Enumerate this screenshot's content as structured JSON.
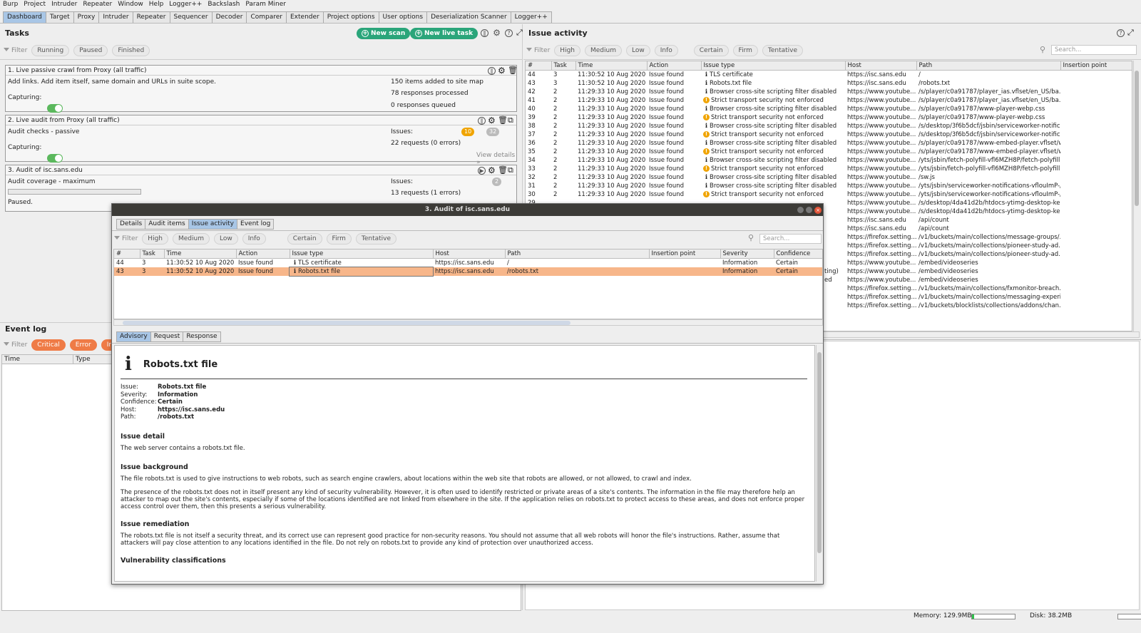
{
  "menubar": [
    "Burp",
    "Project",
    "Intruder",
    "Repeater",
    "Window",
    "Help",
    "Logger++",
    "Backslash",
    "Param Miner"
  ],
  "tabs": [
    "Dashboard",
    "Target",
    "Proxy",
    "Intruder",
    "Repeater",
    "Sequencer",
    "Decoder",
    "Comparer",
    "Extender",
    "Project options",
    "User options",
    "Deserialization Scanner",
    "Logger++"
  ],
  "active_tab": "Dashboard",
  "tasks": {
    "title": "Tasks",
    "new_scan": "New scan",
    "new_live_task": "New live task",
    "filter_label": "Filter",
    "filters": [
      "Running",
      "Paused",
      "Finished"
    ],
    "items": [
      {
        "title": "1. Live passive crawl from Proxy (all traffic)",
        "desc": "Add links. Add item itself, same domain and URLs in suite scope.",
        "capturing_label": "Capturing:",
        "stats": [
          "150 items added to site map",
          "78 responses processed",
          "0 responses queued"
        ]
      },
      {
        "title": "2. Live audit from Proxy (all traffic)",
        "desc": "Audit checks - passive",
        "capturing_label": "Capturing:",
        "issues_label": "Issues:",
        "badge_a": "10",
        "badge_b": "32",
        "requests": "22 requests (0 errors)",
        "view_details": "View details"
      },
      {
        "title": "3. Audit of isc.sans.edu",
        "desc": "Audit coverage - maximum",
        "issues_label": "Issues:",
        "badge_b": "2",
        "requests": "13 requests (1 errors)",
        "paused": "Paused."
      }
    ]
  },
  "eventlog": {
    "title": "Event log",
    "filter_label": "Filter",
    "filters": [
      "Critical",
      "Error",
      "Info"
    ],
    "columns": [
      "Time",
      "Type"
    ]
  },
  "issue_activity": {
    "title": "Issue activity",
    "filter_label": "Filter",
    "severity_filters": [
      "High",
      "Medium",
      "Low",
      "Info"
    ],
    "confidence_filters": [
      "Certain",
      "Firm",
      "Tentative"
    ],
    "search_placeholder": "Search...",
    "columns": [
      "#",
      "Task",
      "Time",
      "Action",
      "Issue type",
      "Host",
      "Path",
      "Insertion point"
    ],
    "rows": [
      [
        "44",
        "3",
        "11:30:52 10 Aug 2020",
        "Issue found",
        "i",
        "TLS certificate",
        "https://isc.sans.edu",
        "/"
      ],
      [
        "43",
        "3",
        "11:30:52 10 Aug 2020",
        "Issue found",
        "i",
        "Robots.txt file",
        "https://isc.sans.edu",
        "/robots.txt"
      ],
      [
        "42",
        "2",
        "11:29:33 10 Aug 2020",
        "Issue found",
        "i",
        "Browser cross-site scripting filter disabled",
        "https://www.youtube....",
        "/s/player/c0a91787/player_ias.vflset/en_US/ba..."
      ],
      [
        "41",
        "2",
        "11:29:33 10 Aug 2020",
        "Issue found",
        "w",
        "Strict transport security not enforced",
        "https://www.youtube....",
        "/s/player/c0a91787/player_ias.vflset/en_US/ba..."
      ],
      [
        "40",
        "2",
        "11:29:33 10 Aug 2020",
        "Issue found",
        "i",
        "Browser cross-site scripting filter disabled",
        "https://www.youtube....",
        "/s/player/c0a91787/www-player-webp.css"
      ],
      [
        "39",
        "2",
        "11:29:33 10 Aug 2020",
        "Issue found",
        "w",
        "Strict transport security not enforced",
        "https://www.youtube....",
        "/s/player/c0a91787/www-player-webp.css"
      ],
      [
        "38",
        "2",
        "11:29:33 10 Aug 2020",
        "Issue found",
        "i",
        "Browser cross-site scripting filter disabled",
        "https://www.youtube....",
        "/s/desktop/3f6b5dcf/jsbin/serviceworker-notific..."
      ],
      [
        "37",
        "2",
        "11:29:33 10 Aug 2020",
        "Issue found",
        "w",
        "Strict transport security not enforced",
        "https://www.youtube....",
        "/s/desktop/3f6b5dcf/jsbin/serviceworker-notific..."
      ],
      [
        "36",
        "2",
        "11:29:33 10 Aug 2020",
        "Issue found",
        "i",
        "Browser cross-site scripting filter disabled",
        "https://www.youtube....",
        "/s/player/c0a91787/www-embed-player.vflset/w..."
      ],
      [
        "35",
        "2",
        "11:29:33 10 Aug 2020",
        "Issue found",
        "w",
        "Strict transport security not enforced",
        "https://www.youtube....",
        "/s/player/c0a91787/www-embed-player.vflset/w..."
      ],
      [
        "34",
        "2",
        "11:29:33 10 Aug 2020",
        "Issue found",
        "i",
        "Browser cross-site scripting filter disabled",
        "https://www.youtube....",
        "/yts/jsbin/fetch-polyfill-vfl6MZH8P/fetch-polyfill.js"
      ],
      [
        "33",
        "2",
        "11:29:33 10 Aug 2020",
        "Issue found",
        "w",
        "Strict transport security not enforced",
        "https://www.youtube....",
        "/yts/jsbin/fetch-polyfill-vfl6MZH8P/fetch-polyfill.js"
      ],
      [
        "32",
        "2",
        "11:29:33 10 Aug 2020",
        "Issue found",
        "i",
        "Browser cross-site scripting filter disabled",
        "https://www.youtube....",
        "/sw.js"
      ],
      [
        "31",
        "2",
        "11:29:33 10 Aug 2020",
        "Issue found",
        "i",
        "Browser cross-site scripting filter disabled",
        "https://www.youtube....",
        "/yts/jsbin/serviceworker-notifications-vflouImP-/..."
      ],
      [
        "30",
        "2",
        "11:29:33 10 Aug 2020",
        "Issue found",
        "w",
        "Strict transport security not enforced",
        "https://www.youtube....",
        "/yts/jsbin/serviceworker-notifications-vflouImP-/..."
      ],
      [
        "29",
        "",
        "",
        "",
        "",
        "",
        "https://www.youtube....",
        "/s/desktop/4da41d2b/htdocs-ytimg-desktop-ke..."
      ],
      [
        "",
        "",
        "",
        "",
        "",
        "",
        "https://www.youtube....",
        "/s/desktop/4da41d2b/htdocs-ytimg-desktop-ke..."
      ],
      [
        "",
        "",
        "",
        "",
        "",
        "",
        "https://isc.sans.edu",
        "/api/count"
      ],
      [
        "",
        "",
        "",
        "",
        "",
        "",
        "https://isc.sans.edu",
        "/api/count"
      ],
      [
        "",
        "",
        "",
        "",
        "",
        "",
        "https://firefox.setting...",
        "/v1/buckets/main/collections/message-groups/..."
      ],
      [
        "",
        "",
        "",
        "",
        "",
        "",
        "https://firefox.setting...",
        "/v1/buckets/main/collections/pioneer-study-ad..."
      ],
      [
        "",
        "",
        "",
        "",
        "",
        "",
        "https://firefox.setting...",
        "/v1/buckets/main/collections/pioneer-study-ad..."
      ],
      [
        "",
        "",
        "",
        "",
        "",
        "",
        "https://www.youtube....",
        "/embed/videoseries"
      ],
      [
        "",
        "",
        "",
        "",
        "",
        "",
        "https://www.youtube....",
        "/embed/videoseries"
      ],
      [
        "",
        "",
        "",
        "",
        "",
        "",
        "https://www.youtube....",
        "/embed/videoseries"
      ],
      [
        "",
        "",
        "",
        "",
        "",
        "",
        "https://firefox.setting...",
        "/v1/buckets/main/collections/fxmonitor-breach..."
      ],
      [
        "",
        "",
        "",
        "",
        "",
        "",
        "https://firefox.setting...",
        "/v1/buckets/main/collections/messaging-experi..."
      ],
      [
        "",
        "",
        "",
        "",
        "",
        "",
        "https://firefox.setting...",
        "/v1/buckets/blocklists/collections/addons/chan..."
      ]
    ],
    "peek_a": "ting)",
    "peek_b": "ed"
  },
  "dialog": {
    "title": "3. Audit of isc.sans.edu",
    "tabs": [
      "Details",
      "Audit items",
      "Issue activity",
      "Event log"
    ],
    "active_tab": "Issue activity",
    "filter_label": "Filter",
    "severity_filters": [
      "High",
      "Medium",
      "Low",
      "Info"
    ],
    "confidence_filters": [
      "Certain",
      "Firm",
      "Tentative"
    ],
    "search_placeholder": "Search...",
    "columns": [
      "#",
      "Task",
      "Time",
      "Action",
      "Issue type",
      "Host",
      "Path",
      "Insertion point",
      "Severity",
      "Confidence"
    ],
    "rows": [
      [
        "44",
        "3",
        "11:30:52 10 Aug 2020",
        "Issue found",
        "TLS certificate",
        "https://isc.sans.edu",
        "/",
        "",
        "Information",
        "Certain"
      ],
      [
        "43",
        "3",
        "11:30:52 10 Aug 2020",
        "Issue found",
        "Robots.txt file",
        "https://isc.sans.edu",
        "/robots.txt",
        "",
        "Information",
        "Certain"
      ]
    ],
    "selected_row": 1,
    "detail_tabs": [
      "Advisory",
      "Request",
      "Response"
    ],
    "active_detail_tab": "Advisory",
    "advisory": {
      "heading": "Robots.txt file",
      "fields": [
        {
          "k": "Issue:",
          "v": "Robots.txt file"
        },
        {
          "k": "Severity:",
          "v": "Information"
        },
        {
          "k": "Confidence:",
          "v": "Certain"
        },
        {
          "k": "Host:",
          "v": "https://isc.sans.edu"
        },
        {
          "k": "Path:",
          "v": "/robots.txt"
        }
      ],
      "detail_title": "Issue detail",
      "detail_text": "The web server contains a robots.txt file.",
      "background_title": "Issue background",
      "background_p1": "The file robots.txt is used to give instructions to web robots, such as search engine crawlers, about locations within the web site that robots are allowed, or not allowed, to crawl and index.",
      "background_p2": "The presence of the robots.txt does not in itself present any kind of security vulnerability. However, it is often used to identify restricted or private areas of a site's contents. The information in the file may therefore help an attacker to map out the site's contents, especially if some of the locations identified are not linked from elsewhere in the site. If the application relies on robots.txt to protect access to these areas, and does not enforce proper access control over them, then this presents a serious vulnerability.",
      "remediation_title": "Issue remediation",
      "remediation_text": "The robots.txt file is not itself a security threat, and its correct use can represent good practice for non-security reasons. You should not assume that all web robots will honor the file's instructions. Rather, assume that attackers will pay close attention to any locations identified in the file. Do not rely on robots.txt to provide any kind of protection over unauthorized access.",
      "classifications_title": "Vulnerability classifications"
    }
  },
  "status": {
    "memory": "Memory: 129.9MB",
    "memory_fill": 0.05,
    "disk": "Disk: 38.2MB",
    "disk_fill": 0.0
  },
  "colors": {
    "accent_tab": "#a8c6e6",
    "green": "#2aa57a",
    "orange": "#ef7b46",
    "selection": "#f7b68a"
  }
}
